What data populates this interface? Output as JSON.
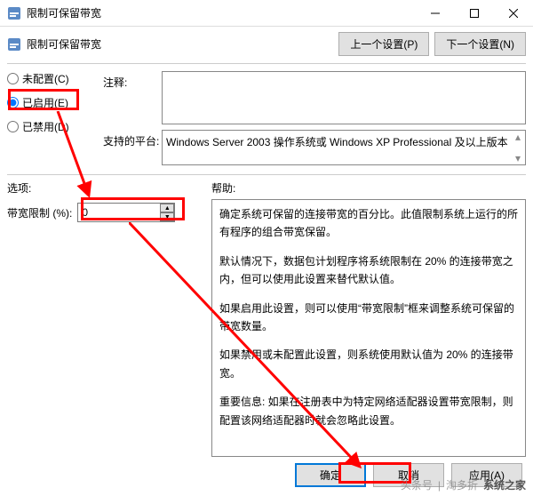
{
  "title": "限制可保留带宽",
  "subheader": "限制可保留带宽",
  "nav": {
    "prev": "上一个设置(P)",
    "next": "下一个设置(N)"
  },
  "radios": {
    "unconfigured": "未配置(C)",
    "enabled": "已启用(E)",
    "disabled": "已禁用(D)"
  },
  "labels": {
    "comment": "注释:",
    "platforms": "支持的平台:",
    "options": "选项:",
    "help": "帮助:",
    "bandwidth": "带宽限制 (%):"
  },
  "platforms_text": "Windows Server 2003 操作系统或 Windows XP Professional 及以上版本",
  "bandwidth_value": "0",
  "help_paragraphs": [
    "确定系统可保留的连接带宽的百分比。此值限制系统上运行的所有程序的组合带宽保留。",
    "默认情况下，数据包计划程序将系统限制在 20% 的连接带宽之内，但可以使用此设置来替代默认值。",
    "如果启用此设置，则可以使用“带宽限制”框来调整系统可保留的带宽数量。",
    "如果禁用或未配置此设置，则系统使用默认值为 20% 的连接带宽。",
    "重要信息: 如果在注册表中为特定网络适配器设置带宽限制，则配置该网络适配器时就会忽略此设置。"
  ],
  "buttons": {
    "ok": "确定",
    "cancel": "取消",
    "apply": "应用(A)"
  },
  "watermark": {
    "a": "头条号",
    "b": "淘多折",
    "c": "系统之家"
  }
}
